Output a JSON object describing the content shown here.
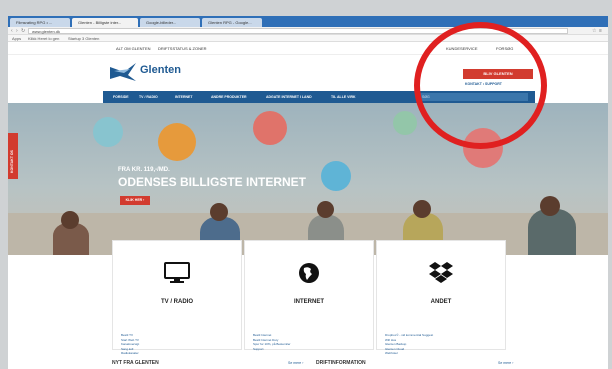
{
  "browser": {
    "tabs": [
      "Filmsrating RPG • ...",
      "Glenten - Billigste inter...",
      "Google-billeder...",
      "Glenten RPG - Google..."
    ],
    "url": "www.glenten.dk",
    "bookmarks": [
      "Apps",
      "Klikk Heret lo gen",
      "Startup 3 Glenten"
    ]
  },
  "site": {
    "topstrip": {
      "left1": "ALT OM GLENTEN",
      "left2": "DRIFTSSTATUS & ZONER",
      "right1": "KUNDESERVICE",
      "right2": "FORSØG"
    },
    "logo_text": "Glenten",
    "cta_label": "BLIV GLENTEN",
    "sublinks": "KONTAKT   •   SUPPORT",
    "nav": [
      "FORSIDE",
      "TV / RADIO",
      "INTERNET",
      "ANDRE PRODUKTER",
      "ADGATE INTERNET I LAND",
      "TIL ALLE VIRK"
    ],
    "search_placeholder": "SØG",
    "hero": {
      "small": "FRA KR. 119,-/MD.",
      "big": "ODENSES BILLIGSTE INTERNET",
      "button": "KLIK HER ›"
    },
    "sidetab": "KONTAKT OS",
    "cards": [
      {
        "title": "TV / RADIO",
        "links": [
          "Bestil TV",
          "Start Web TV",
          "Kanaloversigt",
          "Sang.koll",
          "Radiokanaler"
        ]
      },
      {
        "title": "INTERNET",
        "links": [
          "Bestil Internet",
          "Bestil Internet Duty",
          "Spur for 10%, på Bestemiler",
          "Support"
        ]
      },
      {
        "title": "ANDET",
        "links": [
          "Dropbox© - vid kommercial Suggest",
          "Wifi Hos",
          "Glenten Backup",
          "Glenten Cloud",
          "Webhotel",
          "Glenten Mobil"
        ]
      }
    ],
    "bottom": {
      "left": "NYT FRA GLENTEN",
      "left_more": "Se mere ›",
      "right": "DRIFTINFORMATION",
      "right_more": "Se mere ›"
    }
  },
  "colors": {
    "brand_blue": "#1f5a92",
    "accent_red": "#d23b2f",
    "annotation_red": "#e02020"
  }
}
